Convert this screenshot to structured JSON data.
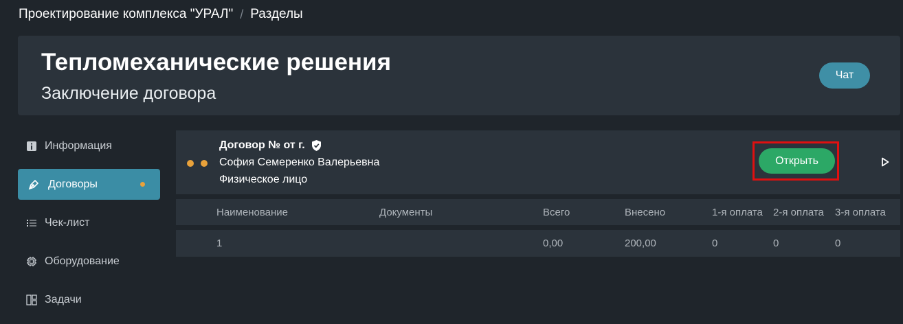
{
  "breadcrumb": {
    "project": "Проектирование комплекса \"УРАЛ\"",
    "separator": "/",
    "current": "Разделы"
  },
  "header": {
    "title": "Тепломеханические решения",
    "subtitle": "Заключение договора",
    "chat_label": "Чат"
  },
  "sidebar": {
    "items": [
      {
        "label": "Информация",
        "icon": "info-icon"
      },
      {
        "label": "Договоры",
        "icon": "pen-icon",
        "active": true,
        "badge_dot": true
      },
      {
        "label": "Чек-лист",
        "icon": "list-icon"
      },
      {
        "label": "Оборудование",
        "icon": "chip-icon"
      },
      {
        "label": "Задачи",
        "icon": "board-icon"
      }
    ]
  },
  "contract": {
    "title": "Договор № от г.",
    "person": "София Семеренко Валерьевна",
    "person_type": "Физическое лицо",
    "open_label": "Открыть",
    "status_dots": 2
  },
  "table": {
    "columns": [
      "Наименование",
      "Документы",
      "Всего",
      "Внесено",
      "1-я оплата",
      "2-я оплата",
      "3-я оплата"
    ],
    "rows": [
      [
        "1",
        "",
        "0,00",
        "200,00",
        "0",
        "0",
        "0"
      ]
    ]
  },
  "colors": {
    "background": "#1f252b",
    "panel": "#2b333b",
    "accent": "#3b8da5",
    "open_button": "#2ca866",
    "status_dot": "#e9a23b",
    "highlight": "#e01010"
  }
}
